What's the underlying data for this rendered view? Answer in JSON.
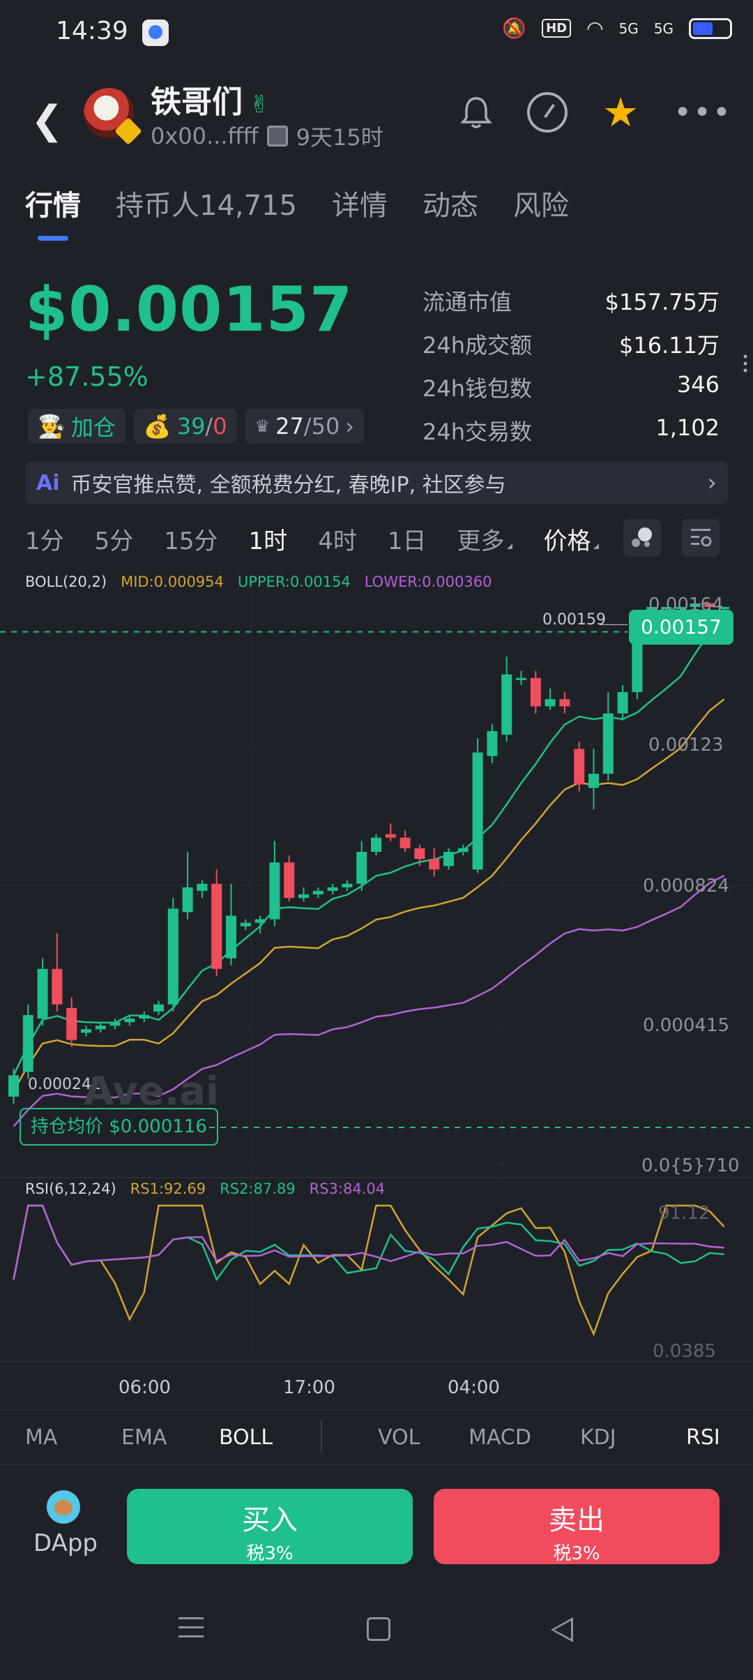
{
  "status_bar": {
    "time": "14:39",
    "hd_label": "HD",
    "net1": "5G",
    "net2": "5G"
  },
  "token": {
    "name": "铁哥们",
    "address": "0x00...ffff",
    "age": "9天15时"
  },
  "tabs": [
    {
      "label": "行情"
    },
    {
      "label": "持币人14,715"
    },
    {
      "label": "详情"
    },
    {
      "label": "动态"
    },
    {
      "label": "风险"
    }
  ],
  "price": {
    "value": "$0.00157",
    "change": "+87.55%"
  },
  "chips": {
    "add_label": "加仓",
    "holders_green": "39",
    "holders_sep": "/",
    "holders_red": "0",
    "top_value": "27",
    "top_total": "/50"
  },
  "stats": [
    {
      "key": "流通市值",
      "value": "$157.75万"
    },
    {
      "key": "24h成交额",
      "value": "$16.11万"
    },
    {
      "key": "24h钱包数",
      "value": "346"
    },
    {
      "key": "24h交易数",
      "value": "1,102"
    }
  ],
  "banner": {
    "ai_label": "Ai",
    "text": "币安官推点赞, 全额税费分红, 春晚IP, 社区参与"
  },
  "intervals": [
    {
      "label": "1分"
    },
    {
      "label": "5分"
    },
    {
      "label": "15分"
    },
    {
      "label": "1时"
    },
    {
      "label": "4时"
    },
    {
      "label": "1日"
    },
    {
      "label": "更多"
    },
    {
      "label": "价格"
    }
  ],
  "boll": {
    "title": "BOLL(20,2)",
    "mid": "MID:0.000954",
    "upper": "UPPER:0.00154",
    "lower": "LOWER:0.000360"
  },
  "price_axis": {
    "labels": [
      "0.00164",
      "0.00123",
      "0.000824",
      "0.000415",
      "0.0{5}710"
    ],
    "current": "0.00157",
    "high": "0.00159",
    "low": "0.000241",
    "avg_cost": "持仓均价 $0.000116",
    "watermark": "Ave.ai"
  },
  "rsi": {
    "title": "RSI(6,12,24)",
    "rs1": "RS1:92.69",
    "rs2": "RS2:87.89",
    "rs3": "RS3:84.04",
    "top": "91.12",
    "bottom": "0.0385"
  },
  "x_axis": [
    "06:00",
    "17:00",
    "04:00"
  ],
  "indicator_tabs": [
    {
      "label": "MA"
    },
    {
      "label": "EMA"
    },
    {
      "label": "BOLL"
    },
    {
      "label": "VOL"
    },
    {
      "label": "MACD"
    },
    {
      "label": "KDJ"
    },
    {
      "label": "RSI"
    }
  ],
  "bottom": {
    "dapp": "DApp",
    "buy_label": "买入",
    "buy_tax": "税3%",
    "sell_label": "卖出",
    "sell_tax": "税3%"
  },
  "colors": {
    "up": "#1fbf8f",
    "down": "#f04e5e",
    "mid": "#d2a530",
    "lower": "#b462d6",
    "accent": "#3d7bff"
  },
  "chart_data": {
    "type": "candlestick",
    "interval": "1时",
    "price_ticks": [
      "0.00164",
      "0.00123",
      "0.000824",
      "0.000415",
      "0.0{5}710"
    ],
    "time_ticks": [
      "06:00",
      "17:00",
      "04:00"
    ],
    "candles": [
      {
        "o": 0.00026,
        "c": 0.00032,
        "h": 0.00034,
        "l": 0.00024
      },
      {
        "o": 0.00033,
        "c": 0.00049,
        "h": 0.00052,
        "l": 0.00031
      },
      {
        "o": 0.00048,
        "c": 0.00062,
        "h": 0.00065,
        "l": 0.00046
      },
      {
        "o": 0.00062,
        "c": 0.00052,
        "h": 0.00072,
        "l": 0.0005
      },
      {
        "o": 0.00051,
        "c": 0.00042,
        "h": 0.00054,
        "l": 0.0004
      },
      {
        "o": 0.00044,
        "c": 0.00045,
        "h": 0.00046,
        "l": 0.00043
      },
      {
        "o": 0.00045,
        "c": 0.00046,
        "h": 0.00047,
        "l": 0.00044
      },
      {
        "o": 0.00046,
        "c": 0.00047,
        "h": 0.00048,
        "l": 0.00045
      },
      {
        "o": 0.00047,
        "c": 0.00048,
        "h": 0.00049,
        "l": 0.00046
      },
      {
        "o": 0.00048,
        "c": 0.00049,
        "h": 0.0005,
        "l": 0.00047
      },
      {
        "o": 0.0005,
        "c": 0.00052,
        "h": 0.00053,
        "l": 0.00049
      },
      {
        "o": 0.00052,
        "c": 0.00079,
        "h": 0.00082,
        "l": 0.0005
      },
      {
        "o": 0.00078,
        "c": 0.00085,
        "h": 0.00095,
        "l": 0.00076
      },
      {
        "o": 0.00084,
        "c": 0.00086,
        "h": 0.00087,
        "l": 0.00082
      },
      {
        "o": 0.00086,
        "c": 0.00062,
        "h": 0.0009,
        "l": 0.0006
      },
      {
        "o": 0.00065,
        "c": 0.00077,
        "h": 0.00086,
        "l": 0.00063
      },
      {
        "o": 0.00074,
        "c": 0.00075,
        "h": 0.00076,
        "l": 0.00073
      },
      {
        "o": 0.00075,
        "c": 0.00076,
        "h": 0.00077,
        "l": 0.00072
      },
      {
        "o": 0.00076,
        "c": 0.00092,
        "h": 0.00098,
        "l": 0.00074
      },
      {
        "o": 0.00092,
        "c": 0.00082,
        "h": 0.00094,
        "l": 0.00081
      },
      {
        "o": 0.00082,
        "c": 0.00083,
        "h": 0.00085,
        "l": 0.00081
      },
      {
        "o": 0.00083,
        "c": 0.00084,
        "h": 0.00085,
        "l": 0.00082
      },
      {
        "o": 0.00084,
        "c": 0.00085,
        "h": 0.00086,
        "l": 0.00083
      },
      {
        "o": 0.00085,
        "c": 0.00086,
        "h": 0.00087,
        "l": 0.00084
      },
      {
        "o": 0.00086,
        "c": 0.00095,
        "h": 0.00098,
        "l": 0.00084
      },
      {
        "o": 0.00095,
        "c": 0.00099,
        "h": 0.001,
        "l": 0.00094
      },
      {
        "o": 0.001,
        "c": 0.00099,
        "h": 0.00103,
        "l": 0.00098
      },
      {
        "o": 0.00099,
        "c": 0.00096,
        "h": 0.00101,
        "l": 0.00095
      },
      {
        "o": 0.00096,
        "c": 0.00093,
        "h": 0.00097,
        "l": 0.00091
      },
      {
        "o": 0.00093,
        "c": 0.0009,
        "h": 0.00096,
        "l": 0.00088
      },
      {
        "o": 0.00091,
        "c": 0.00095,
        "h": 0.00096,
        "l": 0.0009
      },
      {
        "o": 0.00095,
        "c": 0.00096,
        "h": 0.00097,
        "l": 0.00094
      },
      {
        "o": 0.0009,
        "c": 0.00123,
        "h": 0.00127,
        "l": 0.00089
      },
      {
        "o": 0.00122,
        "c": 0.00129,
        "h": 0.00131,
        "l": 0.0012
      },
      {
        "o": 0.00128,
        "c": 0.00145,
        "h": 0.0015,
        "l": 0.00126
      },
      {
        "o": 0.00144,
        "c": 0.00144,
        "h": 0.00146,
        "l": 0.00142
      },
      {
        "o": 0.00144,
        "c": 0.00136,
        "h": 0.00146,
        "l": 0.00134
      },
      {
        "o": 0.00136,
        "c": 0.00138,
        "h": 0.00141,
        "l": 0.00135
      },
      {
        "o": 0.00138,
        "c": 0.00136,
        "h": 0.0014,
        "l": 0.00134
      },
      {
        "o": 0.00124,
        "c": 0.00114,
        "h": 0.00126,
        "l": 0.00112
      },
      {
        "o": 0.00113,
        "c": 0.00117,
        "h": 0.00124,
        "l": 0.00107
      },
      {
        "o": 0.00117,
        "c": 0.00134,
        "h": 0.0014,
        "l": 0.00115
      },
      {
        "o": 0.00134,
        "c": 0.0014,
        "h": 0.00142,
        "l": 0.00132
      },
      {
        "o": 0.0014,
        "c": 0.00159,
        "h": 0.00162,
        "l": 0.00138
      },
      {
        "o": 0.00159,
        "c": 0.00164,
        "h": 0.00164,
        "l": 0.00158
      },
      {
        "o": 0.00164,
        "c": 0.00164,
        "h": 0.00164,
        "l": 0.00162
      },
      {
        "o": 0.00164,
        "c": 0.00164,
        "h": 0.00164,
        "l": 0.00163
      },
      {
        "o": 0.00164,
        "c": 0.00165,
        "h": 0.00165,
        "l": 0.00163
      },
      {
        "o": 0.00165,
        "c": 0.00164,
        "h": 0.00165,
        "l": 0.00163
      },
      {
        "o": 0.00164,
        "c": 0.00164,
        "h": 0.00164,
        "l": 0.00163
      }
    ]
  }
}
